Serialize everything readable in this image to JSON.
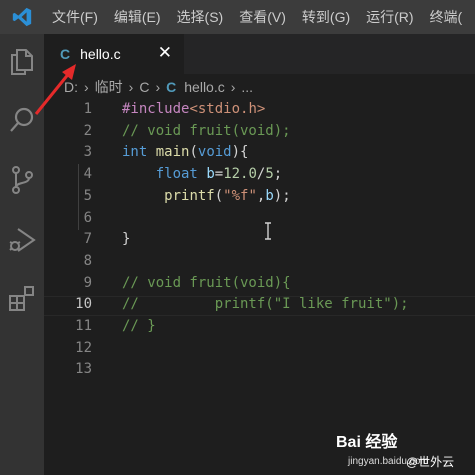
{
  "menu": [
    "文件(F)",
    "编辑(E)",
    "选择(S)",
    "查看(V)",
    "转到(G)",
    "运行(R)",
    "终端("
  ],
  "activity_bar": [
    "explorer-icon",
    "search-icon",
    "source-control-icon",
    "run-debug-icon",
    "extensions-icon"
  ],
  "tab": {
    "icon": "C",
    "label": "hello.c",
    "close": "✕"
  },
  "breadcrumb": {
    "segments": [
      "D:",
      "临时",
      "C"
    ],
    "file_icon": "C",
    "file": "hello.c",
    "more": "..."
  },
  "editor": {
    "active_line": "10",
    "lines": [
      {
        "num": "1",
        "tokens": [
          {
            "t": "#include",
            "c": "pp"
          },
          {
            "t": "<stdio.h>",
            "c": "str"
          }
        ]
      },
      {
        "num": "2",
        "tokens": [
          {
            "t": "// void fruit(void);",
            "c": "cmt"
          }
        ]
      },
      {
        "num": "3",
        "tokens": [
          {
            "t": "int",
            "c": "kw"
          },
          {
            "t": " ",
            "c": "plain"
          },
          {
            "t": "main",
            "c": "fn"
          },
          {
            "t": "(",
            "c": "plain"
          },
          {
            "t": "void",
            "c": "kw"
          },
          {
            "t": "){",
            "c": "plain"
          }
        ]
      },
      {
        "num": "4",
        "tokens": [
          {
            "t": "    ",
            "c": "plain"
          },
          {
            "t": "float",
            "c": "kw"
          },
          {
            "t": " ",
            "c": "plain"
          },
          {
            "t": "b",
            "c": "var"
          },
          {
            "t": "=",
            "c": "plain"
          },
          {
            "t": "12.0",
            "c": "num"
          },
          {
            "t": "/",
            "c": "plain"
          },
          {
            "t": "5",
            "c": "num"
          },
          {
            "t": ";",
            "c": "plain"
          }
        ]
      },
      {
        "num": "5",
        "tokens": [
          {
            "t": "     ",
            "c": "plain"
          },
          {
            "t": "printf",
            "c": "fn"
          },
          {
            "t": "(",
            "c": "plain"
          },
          {
            "t": "\"%f\"",
            "c": "str"
          },
          {
            "t": ",",
            "c": "plain"
          },
          {
            "t": "b",
            "c": "var"
          },
          {
            "t": ");",
            "c": "plain"
          }
        ]
      },
      {
        "num": "6",
        "tokens": []
      },
      {
        "num": "7",
        "tokens": [
          {
            "t": "}",
            "c": "plain"
          }
        ]
      },
      {
        "num": "8",
        "tokens": []
      },
      {
        "num": "9",
        "tokens": [
          {
            "t": "// void fruit(void){",
            "c": "cmt"
          }
        ]
      },
      {
        "num": "10",
        "tokens": [
          {
            "t": "//         printf(\"I like fruit\");",
            "c": "cmt"
          }
        ]
      },
      {
        "num": "11",
        "tokens": [
          {
            "t": "// }",
            "c": "cmt"
          }
        ]
      },
      {
        "num": "12",
        "tokens": []
      },
      {
        "num": "13",
        "tokens": []
      }
    ]
  },
  "watermark": {
    "brand": "Bai 经验",
    "domain": "jingyan.baidu.com",
    "author": "@世外云"
  },
  "colors": {
    "menubar": "#3c3c3c",
    "activitybar": "#333333",
    "editor_bg": "#1e1e1e",
    "tabstrip": "#252526",
    "annotation_arrow": "#e52a2a",
    "c_file_icon": "#519aba"
  }
}
